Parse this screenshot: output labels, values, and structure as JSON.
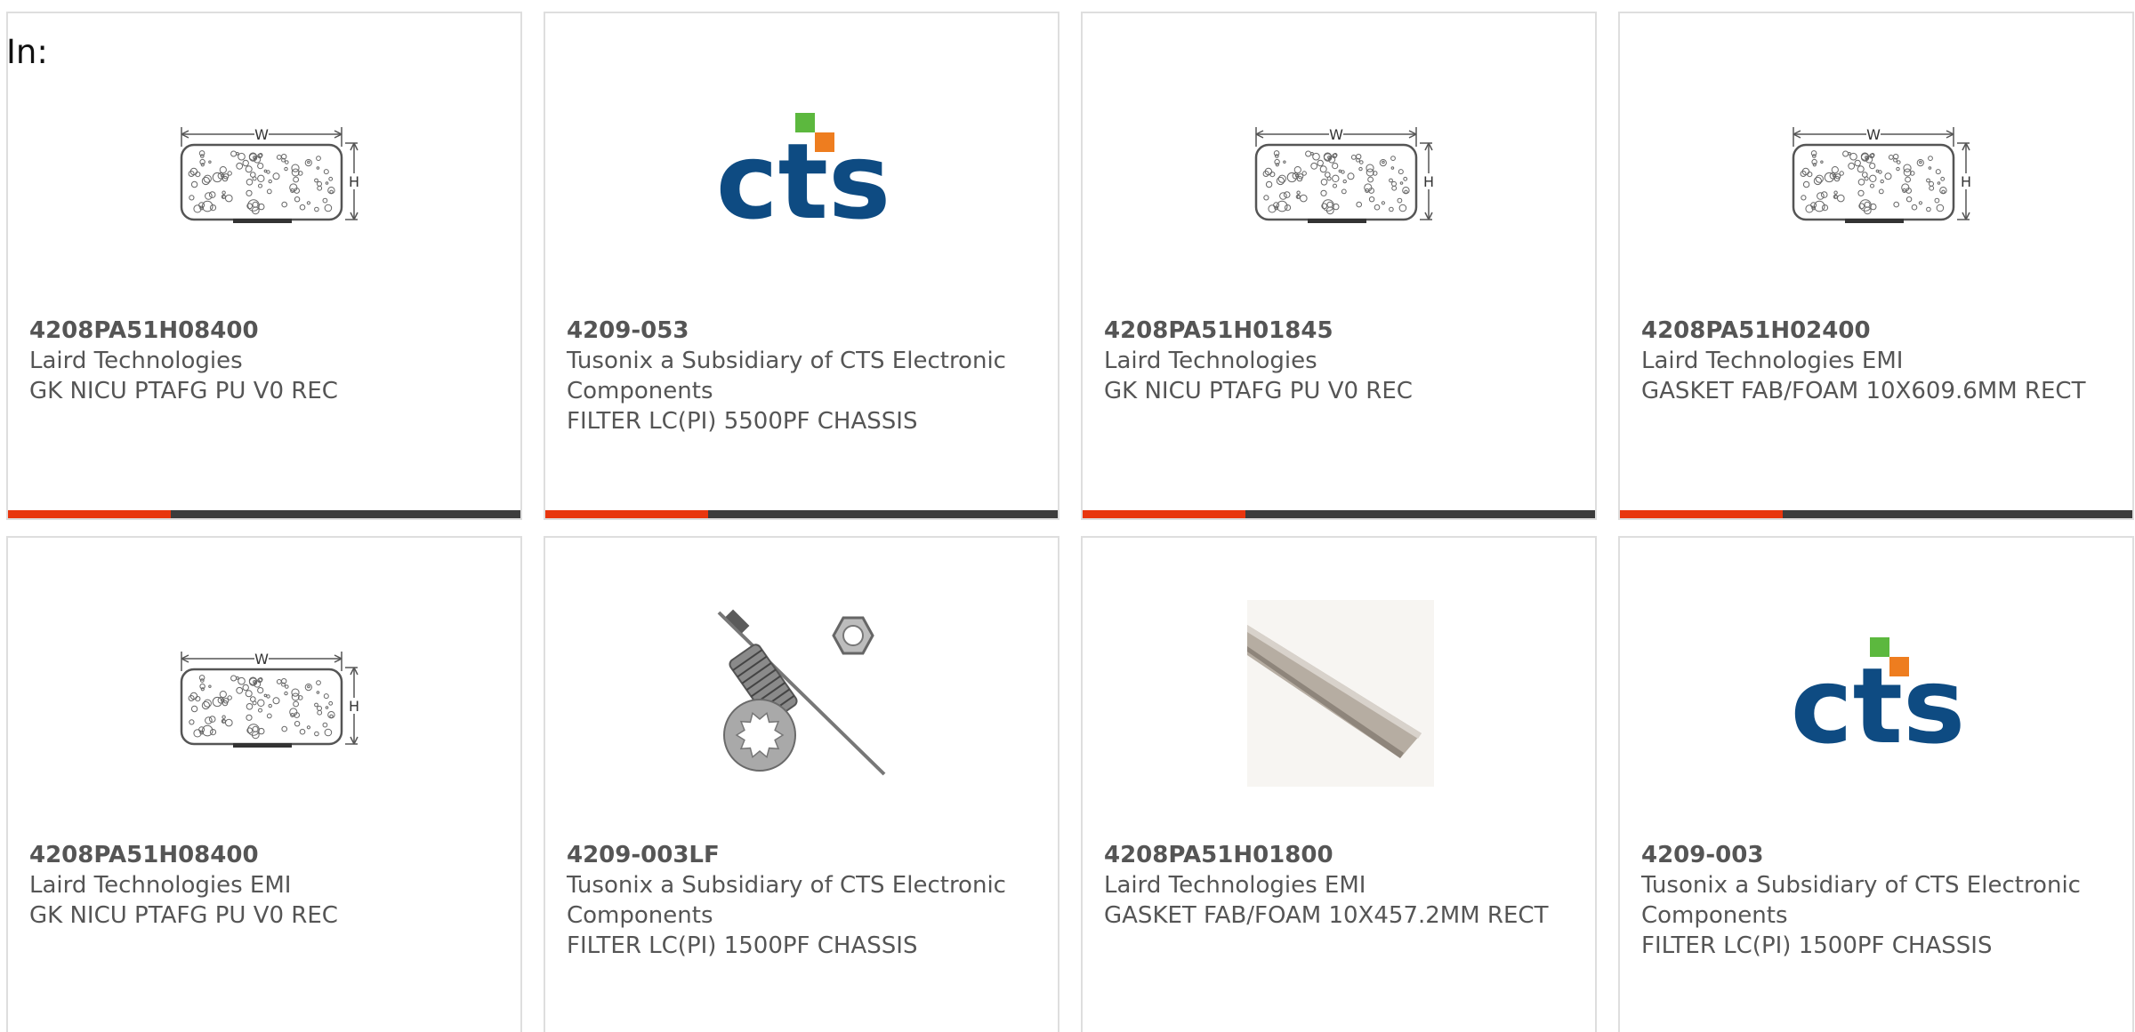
{
  "filter_label": "In:",
  "colors": {
    "accent": "#E8360E",
    "bar_dark": "#3C3C3C",
    "cts_blue": "#0E4B82",
    "cts_green": "#5CB83E",
    "cts_orange": "#EE7D1F"
  },
  "logo_text": "cts",
  "drawing_labels": {
    "width": "W",
    "height": "H"
  },
  "products": [
    {
      "part_number": "4208PA51H08400",
      "manufacturer": "Laird Technologies",
      "description": "GK NICU PTAFG PU V0 REC",
      "image": "gasket-drawing-icon",
      "bar": true
    },
    {
      "part_number": "4209-053",
      "manufacturer": "Tusonix a Subsidiary of CTS Electronic Components",
      "description": "FILTER LC(PI) 5500PF CHASSIS",
      "image": "cts-logo",
      "bar": true
    },
    {
      "part_number": "4208PA51H01845",
      "manufacturer": "Laird Technologies",
      "description": "GK NICU PTAFG PU V0 REC",
      "image": "gasket-drawing-icon",
      "bar": true
    },
    {
      "part_number": "4208PA51H02400",
      "manufacturer": "Laird Technologies EMI",
      "description": "GASKET FAB/FOAM 10X609.6MM RECT",
      "image": "gasket-drawing-icon",
      "bar": true
    },
    {
      "part_number": "4208PA51H08400",
      "manufacturer": "Laird Technologies EMI",
      "description": "GK NICU PTAFG PU V0 REC",
      "image": "gasket-drawing-icon",
      "bar": false
    },
    {
      "part_number": "4209-003LF",
      "manufacturer": "Tusonix a Subsidiary of CTS Electronic Components",
      "description": "FILTER LC(PI) 1500PF CHASSIS",
      "image": "feedthrough-filter-photo",
      "bar": false
    },
    {
      "part_number": "4208PA51H01800",
      "manufacturer": "Laird Technologies EMI",
      "description": "GASKET FAB/FOAM 10X457.2MM RECT",
      "image": "gasket-strip-photo",
      "bar": false
    },
    {
      "part_number": "4209-003",
      "manufacturer": "Tusonix a Subsidiary of CTS Electronic Components",
      "description": "FILTER LC(PI) 1500PF CHASSIS",
      "image": "cts-logo",
      "bar": false
    }
  ]
}
